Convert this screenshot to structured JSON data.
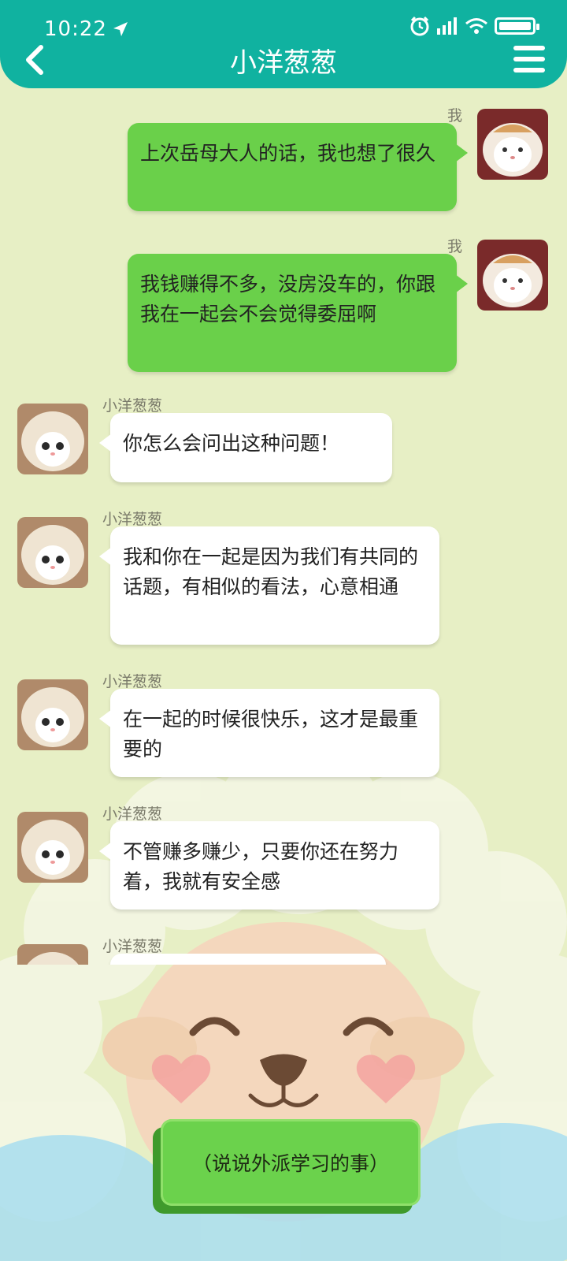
{
  "status_bar": {
    "time": "10:22"
  },
  "header": {
    "title": "小洋葱葱"
  },
  "messages": [
    {
      "sender": "我",
      "side": "me",
      "text": "上次岳母大人的话，我也想了很久"
    },
    {
      "sender": "我",
      "side": "me",
      "text": "我钱赚得不多，没房没车的，你跟我在一起会不会觉得委屈啊"
    },
    {
      "sender": "小洋葱葱",
      "side": "them",
      "text": "你怎么会问出这种问题！"
    },
    {
      "sender": "小洋葱葱",
      "side": "them",
      "text": "我和你在一起是因为我们有共同的话题，有相似的看法，心意相通"
    },
    {
      "sender": "小洋葱葱",
      "side": "them",
      "text": "在一起的时候很快乐，这才是最重要的"
    },
    {
      "sender": "小洋葱葱",
      "side": "them",
      "text": "不管赚多赚少，只要你还在努力着，我就有安全感"
    },
    {
      "sender": "小洋葱葱",
      "side": "them",
      "text": ""
    }
  ],
  "reply_option": {
    "label": "（说说外派学习的事）"
  },
  "colors": {
    "header": "#10b2a0",
    "background": "#e7efc5",
    "my_bubble": "#6ad04a",
    "their_bubble": "#ffffff"
  },
  "icons": {
    "back": "chevron-left-icon",
    "menu": "hamburger-menu-icon",
    "location": "location-arrow-icon",
    "alarm": "alarm-icon",
    "signal": "signal-icon",
    "wifi": "wifi-icon",
    "battery": "battery-icon"
  }
}
